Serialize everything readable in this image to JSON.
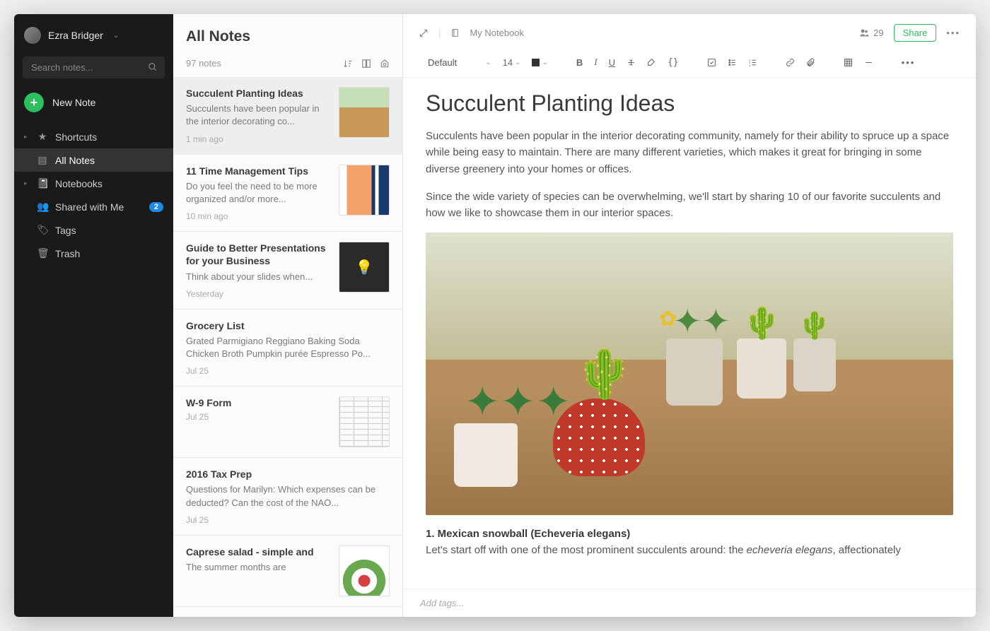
{
  "user": {
    "name": "Ezra Bridger"
  },
  "search": {
    "placeholder": "Search notes..."
  },
  "newNote": {
    "label": "New Note"
  },
  "nav": {
    "items": [
      {
        "label": "Shortcuts",
        "icon": "★",
        "caret": "▸"
      },
      {
        "label": "All Notes",
        "icon": "▤",
        "caret": "",
        "active": true
      },
      {
        "label": "Notebooks",
        "icon": "📓",
        "caret": "▸"
      },
      {
        "label": "Shared with Me",
        "icon": "👥",
        "caret": "",
        "badge": "2"
      },
      {
        "label": "Tags",
        "icon": "🏷",
        "caret": ""
      },
      {
        "label": "Trash",
        "icon": "🗑",
        "caret": ""
      }
    ]
  },
  "list": {
    "title": "All Notes",
    "count": "97 notes",
    "notes": [
      {
        "title": "Succulent Planting Ideas",
        "snippet": "Succulents have been popular in the interior decorating co...",
        "date": "1 min ago",
        "thumb": "succ",
        "selected": true
      },
      {
        "title": "11 Time Management Tips",
        "snippet": "Do you feel the need to be more organized and/or more...",
        "date": "10 min ago",
        "thumb": "timer"
      },
      {
        "title": "Guide to Better Presentations for your Business",
        "snippet": "Think about your slides when...",
        "date": "Yesterday",
        "thumb": "bulb"
      },
      {
        "title": "Grocery List",
        "snippet": "Grated Parmigiano Reggiano Baking Soda Chicken Broth Pumpkin purée Espresso Po...",
        "date": "Jul 25",
        "thumb": ""
      },
      {
        "title": "W-9 Form",
        "snippet": "",
        "date": "Jul 25",
        "thumb": "form"
      },
      {
        "title": "2016 Tax Prep",
        "snippet": "Questions for Marilyn: Which expenses can be deducted? Can the cost of the NAO...",
        "date": "Jul 25",
        "thumb": ""
      },
      {
        "title": "Caprese salad - simple and",
        "snippet": "The summer months are",
        "date": "",
        "thumb": "salad"
      }
    ]
  },
  "editor": {
    "notebook": "My Notebook",
    "shareCount": "29",
    "shareLabel": "Share",
    "font": "Default",
    "fontSize": "14",
    "doc": {
      "title": "Succulent Planting Ideas",
      "p1": "Succulents have been popular in the interior decorating community, namely for their ability to spruce up a space while being easy to maintain. There are many different varieties, which makes it great for bringing in some diverse greenery into your homes or offices.",
      "p2": "Since the wide variety of species can be overwhelming, we'll start by sharing 10 of our favorite succulents and how we like to showcase them in our interior spaces.",
      "h1": "1. Mexican snowball (Echeveria elegans)",
      "sub1a": "Let's start off with one of the most prominent succulents around: the ",
      "sub1em": "echeveria elegans",
      "sub1b": ", affectionately"
    },
    "tagPlaceholder": "Add tags..."
  }
}
